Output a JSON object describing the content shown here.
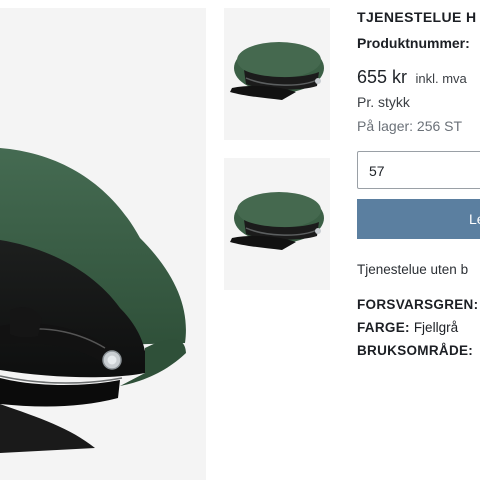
{
  "product": {
    "title": "TJENESTELUE H",
    "product_number_label": "Produktnummer:",
    "price": "655 kr",
    "vat_note": "inkl. mva",
    "unit": "Pr. stykk",
    "stock": "På lager: 256 ST",
    "size_selected": "57",
    "add_button_label": "Le",
    "description": "Tjenestelue uten b",
    "attributes": [
      {
        "key": "FORSVARSGREN:",
        "value": ""
      },
      {
        "key": "FARGE:",
        "value": "Fjellgrå"
      },
      {
        "key": "BRUKSOMRÅDE:",
        "value": ""
      }
    ]
  },
  "colors": {
    "cap_green": "#3a5e46",
    "button_blue": "#5b7fa0"
  },
  "icons": {
    "main": "service-cap-image",
    "thumb1": "service-cap-thumbnail",
    "thumb2": "service-cap-thumbnail"
  }
}
